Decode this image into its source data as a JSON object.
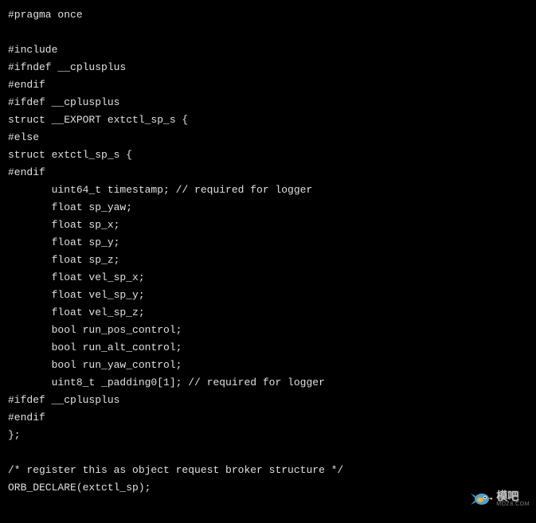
{
  "code": {
    "l1": "#pragma once",
    "l2": "",
    "l3": "#include",
    "l4": "#ifndef __cplusplus",
    "l5": "#endif",
    "l6": "#ifdef __cplusplus",
    "l7": "struct __EXPORT extctl_sp_s {",
    "l8": "#else",
    "l9": "struct extctl_sp_s {",
    "l10": "#endif",
    "l11": "       uint64_t timestamp; // required for logger",
    "l12": "       float sp_yaw;",
    "l13": "       float sp_x;",
    "l14": "       float sp_y;",
    "l15": "       float sp_z;",
    "l16": "       float vel_sp_x;",
    "l17": "       float vel_sp_y;",
    "l18": "       float vel_sp_z;",
    "l19": "       bool run_pos_control;",
    "l20": "       bool run_alt_control;",
    "l21": "       bool run_yaw_control;",
    "l22": "       uint8_t _padding0[1]; // required for logger",
    "l23": "#ifdef __cplusplus",
    "l24": "#endif",
    "l25": "};",
    "l26": "",
    "l27": "/* register this as object request broker structure */",
    "l28": "ORB_DECLARE(extctl_sp);"
  },
  "watermark": {
    "text": "模吧",
    "sub": "MOZ8.COM"
  }
}
